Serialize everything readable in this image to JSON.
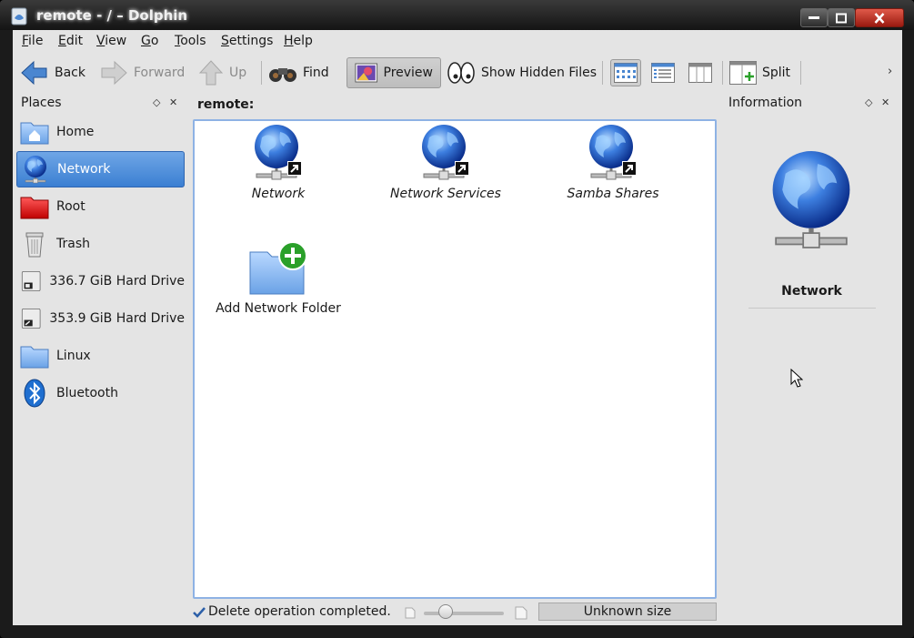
{
  "window": {
    "title": "remote - / – Dolphin"
  },
  "menubar": [
    {
      "pre": "",
      "u": "F",
      "post": "ile"
    },
    {
      "pre": "",
      "u": "E",
      "post": "dit"
    },
    {
      "pre": "",
      "u": "V",
      "post": "iew"
    },
    {
      "pre": "",
      "u": "G",
      "post": "o"
    },
    {
      "pre": "",
      "u": "T",
      "post": "ools"
    },
    {
      "pre": "",
      "u": "S",
      "post": "ettings"
    },
    {
      "pre": "",
      "u": "H",
      "post": "elp"
    }
  ],
  "toolbar": {
    "back": "Back",
    "forward": "Forward",
    "up": "Up",
    "find": "Find",
    "preview": "Preview",
    "hidden": "Show Hidden Files",
    "split": "Split"
  },
  "places": {
    "title": "Places",
    "items": [
      {
        "label": "Home",
        "icon": "home-folder-icon"
      },
      {
        "label": "Network",
        "icon": "network-globe-icon"
      },
      {
        "label": "Root",
        "icon": "root-folder-icon"
      },
      {
        "label": "Trash",
        "icon": "trash-icon"
      },
      {
        "label": "336.7 GiB Hard Drive",
        "icon": "hard-drive-icon"
      },
      {
        "label": "353.9 GiB Hard Drive",
        "icon": "hard-drive-icon"
      },
      {
        "label": "Linux",
        "icon": "folder-icon"
      },
      {
        "label": "Bluetooth",
        "icon": "bluetooth-icon"
      }
    ],
    "selected": "Network"
  },
  "location": "remote:",
  "items": [
    {
      "label": "Network",
      "icon": "network-globe-link-icon"
    },
    {
      "label": "Network Services",
      "icon": "network-globe-link-icon"
    },
    {
      "label": "Samba Shares",
      "icon": "network-globe-link-icon"
    },
    {
      "label": "Add Network Folder",
      "icon": "add-folder-icon"
    }
  ],
  "info": {
    "title": "Information",
    "name": "Network"
  },
  "status": {
    "message": "Delete operation completed.",
    "size": "Unknown size"
  },
  "colors": {
    "selection": "#3b7fd2",
    "view_border": "#8eb2e4"
  }
}
